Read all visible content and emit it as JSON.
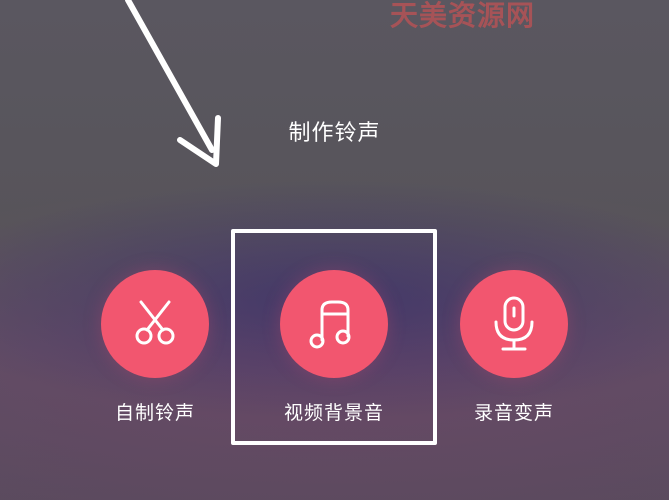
{
  "watermark": "天美资源网",
  "title": "制作铃声",
  "options": [
    {
      "label": "自制铃声",
      "icon": "scissors-icon"
    },
    {
      "label": "视频背景音",
      "icon": "music-note-icon"
    },
    {
      "label": "录音变声",
      "icon": "microphone-icon"
    }
  ],
  "colors": {
    "accent": "#f2566f",
    "background": "#58555b",
    "annotation": "#ffffff"
  }
}
